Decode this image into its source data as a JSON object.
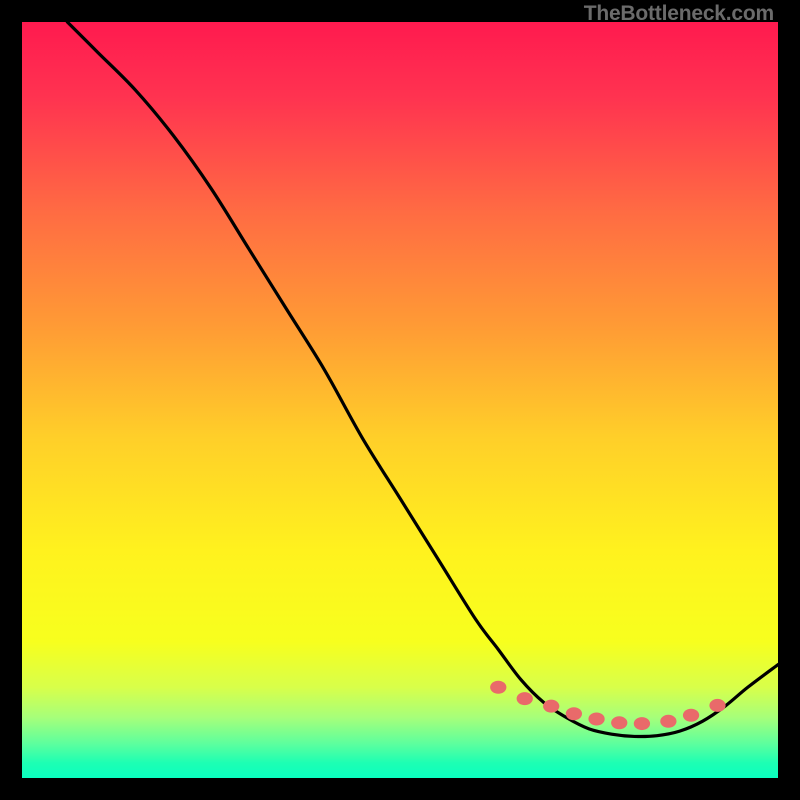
{
  "watermark": "TheBottleneck.com",
  "chart_data": {
    "type": "line",
    "title": "",
    "xlabel": "",
    "ylabel": "",
    "xlim": [
      0,
      100
    ],
    "ylim": [
      0,
      100
    ],
    "grid": false,
    "legend": false,
    "series": [
      {
        "name": "curve",
        "x": [
          6,
          10,
          15,
          20,
          25,
          30,
          35,
          40,
          45,
          50,
          55,
          60,
          63,
          66,
          69,
          72,
          75,
          78,
          81,
          84,
          87,
          90,
          93,
          96,
          100
        ],
        "values": [
          100,
          96,
          91,
          85,
          78,
          70,
          62,
          54,
          45,
          37,
          29,
          21,
          17,
          13,
          10,
          8,
          6.5,
          5.8,
          5.5,
          5.6,
          6.2,
          7.5,
          9.5,
          12,
          15
        ]
      }
    ],
    "markers": {
      "name": "dots",
      "color": "#e96a6a",
      "x": [
        63,
        66.5,
        70,
        73,
        76,
        79,
        82,
        85.5,
        88.5,
        92
      ],
      "values": [
        12,
        10.5,
        9.5,
        8.5,
        7.8,
        7.3,
        7.2,
        7.5,
        8.3,
        9.6
      ],
      "r": 6.5
    },
    "gradient_stops": [
      {
        "offset": 0.0,
        "color": "#ff1a4f"
      },
      {
        "offset": 0.1,
        "color": "#ff3350"
      },
      {
        "offset": 0.25,
        "color": "#ff6b43"
      },
      {
        "offset": 0.4,
        "color": "#ff9a35"
      },
      {
        "offset": 0.55,
        "color": "#ffcf29"
      },
      {
        "offset": 0.7,
        "color": "#fff21e"
      },
      {
        "offset": 0.82,
        "color": "#f7ff1e"
      },
      {
        "offset": 0.88,
        "color": "#d8ff4a"
      },
      {
        "offset": 0.92,
        "color": "#a6ff7a"
      },
      {
        "offset": 0.955,
        "color": "#5cff9e"
      },
      {
        "offset": 0.98,
        "color": "#1dffb3"
      },
      {
        "offset": 1.0,
        "color": "#0affc0"
      }
    ]
  }
}
